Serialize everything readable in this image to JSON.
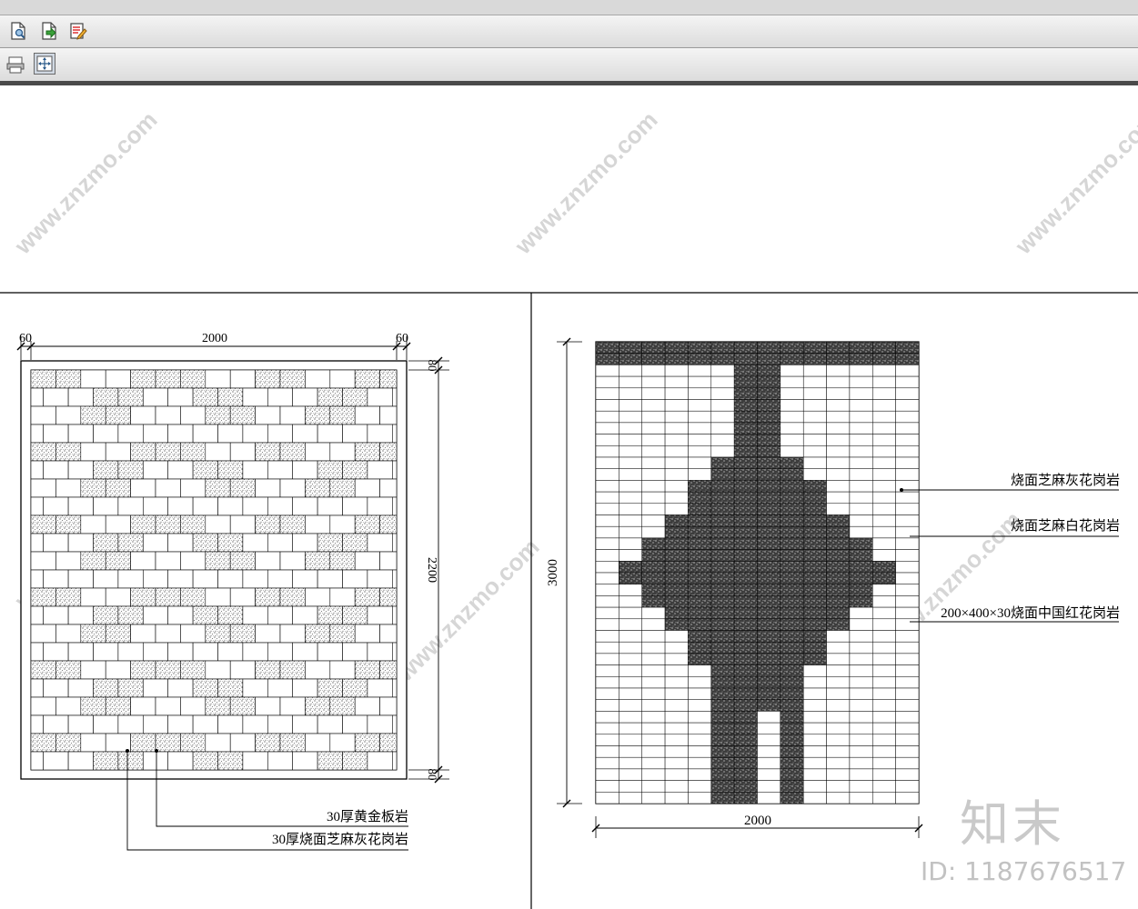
{
  "toolbar": {
    "row1": [
      {
        "name": "preview-doc-icon"
      },
      {
        "name": "export-doc-icon"
      },
      {
        "name": "edit-doc-icon"
      }
    ],
    "row2": [
      {
        "name": "print-icon"
      },
      {
        "name": "zoom-extents-icon"
      }
    ]
  },
  "left_drawing": {
    "dim_top_left": "60",
    "dim_top_mid": "2000",
    "dim_top_right": "60",
    "dim_right_top": "80",
    "dim_right_mid": "2200",
    "dim_right_bottom": "80",
    "callout1": "30厚黄金板岩",
    "callout2": "30厚烧面芝麻灰花岗岩"
  },
  "right_drawing": {
    "dim_left": "3000",
    "dim_bottom": "2000",
    "callout1": "烧面芝麻灰花岗岩",
    "callout2": "烧面芝麻白花岗岩",
    "callout3": "200×400×30烧面中国红花岗岩"
  },
  "watermark": {
    "logo": "知末",
    "id": "ID: 1187676517",
    "site": "www.znzmo.com"
  }
}
